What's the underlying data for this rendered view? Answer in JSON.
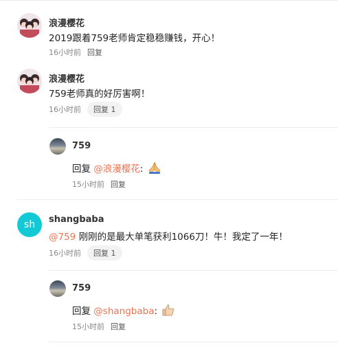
{
  "comments": [
    {
      "user": "浪漫樱花",
      "text": "2019跟着759老师肯定稳稳赚钱，开心！",
      "time": "16小时前",
      "reply_label": "回复"
    },
    {
      "user": "浪漫樱花",
      "text": "759老师真的好厉害啊！",
      "time": "16小时前",
      "reply_label": "回复 1",
      "reply": {
        "user": "759",
        "prefix": "回复 ",
        "mention": "@浪漫樱花",
        "suffix": ":",
        "emoji": "pray-hands-icon",
        "time": "15小时前",
        "reply_label": "回复"
      }
    },
    {
      "user": "shangbaba",
      "avatar_letter": "sh",
      "mention": "@759",
      "text": " 刚刚的是最大单笔获利1066刀！牛！我定了一年！",
      "time": "16小时前",
      "reply_label": "回复 1",
      "reply": {
        "user": "759",
        "prefix": "回复 ",
        "mention": "@shangbaba",
        "suffix": ":",
        "emoji": "thumbs-up-icon",
        "time": "15小时前",
        "reply_label": "回复"
      }
    }
  ],
  "colors": {
    "mention": "#eb7350",
    "avatar_teal": "#13c9d6",
    "meta": "#888888"
  }
}
